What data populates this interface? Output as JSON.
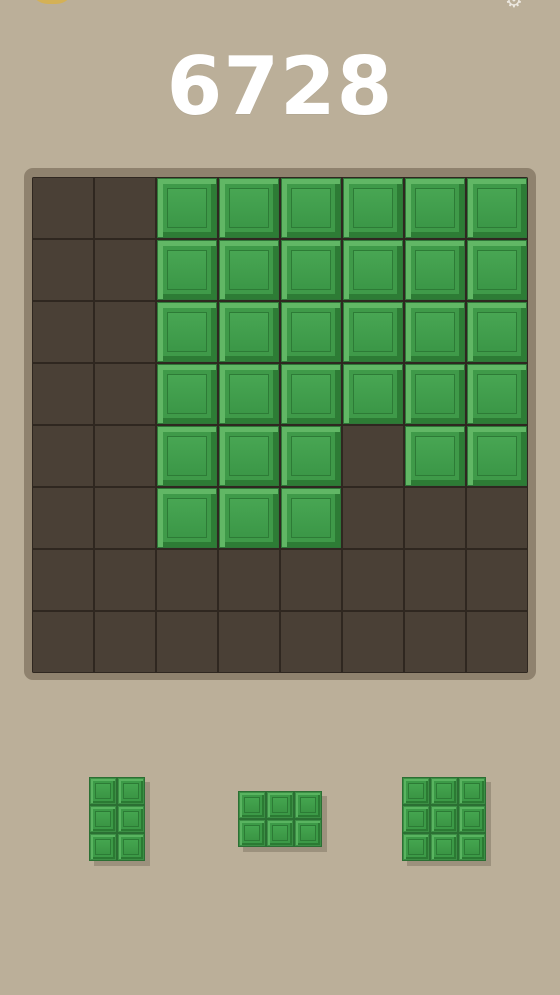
{
  "score": "6728",
  "icons": {
    "top_left": "coin-icon",
    "top_right": "settings-gear-icon"
  },
  "colors": {
    "background": "#bbaf99",
    "board_frame": "#8f826e",
    "empty_cell": "#4a4036",
    "block_green": "#3f9a49",
    "score_text": "#ffffff"
  },
  "board": {
    "rows": 8,
    "cols": 8,
    "cells": [
      [
        0,
        0,
        1,
        1,
        1,
        1,
        1,
        1
      ],
      [
        0,
        0,
        1,
        1,
        1,
        1,
        1,
        1
      ],
      [
        0,
        0,
        1,
        1,
        1,
        1,
        1,
        1
      ],
      [
        0,
        0,
        1,
        1,
        1,
        1,
        1,
        1
      ],
      [
        0,
        0,
        1,
        1,
        1,
        0,
        1,
        1
      ],
      [
        0,
        0,
        1,
        1,
        1,
        0,
        0,
        0
      ],
      [
        0,
        0,
        0,
        0,
        0,
        0,
        0,
        0
      ],
      [
        0,
        0,
        0,
        0,
        0,
        0,
        0,
        0
      ]
    ]
  },
  "pieces": [
    {
      "name": "piece-2x3-vertical",
      "rows": 3,
      "cols": 2
    },
    {
      "name": "piece-3x2-horizontal",
      "rows": 2,
      "cols": 3
    },
    {
      "name": "piece-3x3-square",
      "rows": 3,
      "cols": 3
    }
  ]
}
